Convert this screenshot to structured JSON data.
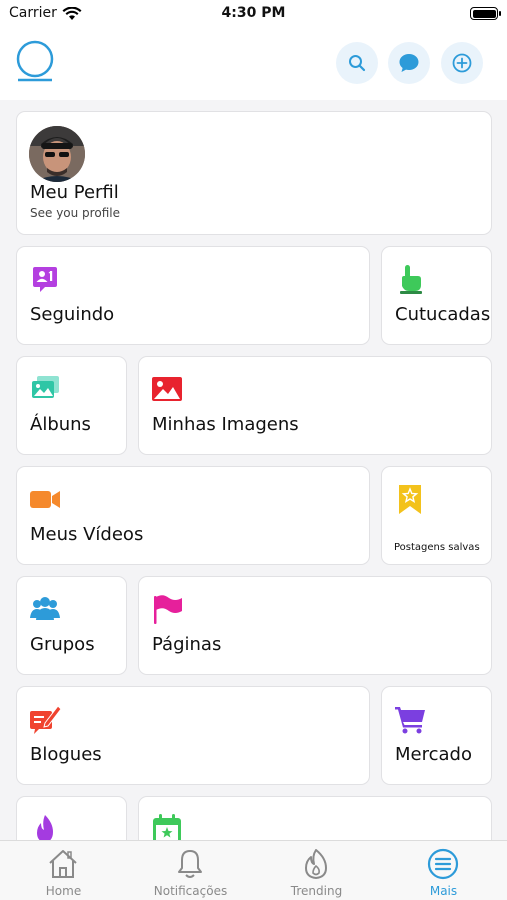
{
  "status_bar": {
    "carrier": "Carrier",
    "time": "4:30 PM"
  },
  "header": {
    "logo_icon": "ring-logo-icon",
    "search_icon": "search-icon",
    "chat_icon": "chat-bubble-icon",
    "add_icon": "plus-circle-icon",
    "accent": "#2d9bd9"
  },
  "profile": {
    "name": "Meu Perfil",
    "subtitle": "See you profile"
  },
  "menu": [
    {
      "key": "seguindo",
      "label": "Seguindo",
      "icon": "following-icon",
      "color": "#b43fe0"
    },
    {
      "key": "cutucadas",
      "label": "Cutucadas",
      "icon": "poke-hand-icon",
      "color": "#3ec95a"
    },
    {
      "key": "albuns",
      "label": "Álbuns",
      "icon": "photo-album-icon",
      "color": "#2fc6a6"
    },
    {
      "key": "minhas_imagens",
      "label": "Minhas Imagens",
      "icon": "image-icon",
      "color": "#e8232e"
    },
    {
      "key": "meus_videos",
      "label": "Meus Vídeos",
      "icon": "video-camera-icon",
      "color": "#f5892c"
    },
    {
      "key": "postagens_salvas",
      "label": "Postagens salvas",
      "icon": "bookmark-star-icon",
      "color": "#f3c21c"
    },
    {
      "key": "grupos",
      "label": "Grupos",
      "icon": "group-icon",
      "color": "#2d9bd9"
    },
    {
      "key": "paginas",
      "label": "Páginas",
      "icon": "flag-icon",
      "color": "#e6209b"
    },
    {
      "key": "blogues",
      "label": "Blogues",
      "icon": "blog-pencil-icon",
      "color": "#f0432f"
    },
    {
      "key": "mercado",
      "label": "Mercado",
      "icon": "shopping-cart-icon",
      "color": "#7b3fe0"
    },
    {
      "key": "fire",
      "label": "",
      "icon": "fire-icon",
      "color": "#a43be0"
    },
    {
      "key": "events",
      "label": "",
      "icon": "calendar-icon",
      "color": "#3ec95a"
    }
  ],
  "tabs": [
    {
      "label": "Home",
      "icon": "home-icon",
      "active": false
    },
    {
      "label": "Notificações",
      "icon": "bell-icon",
      "active": false
    },
    {
      "label": "Trending",
      "icon": "fire-icon",
      "active": false
    },
    {
      "label": "Mais",
      "icon": "menu-lines-icon",
      "active": true
    }
  ],
  "tab_inactive_color": "#8a8a8a"
}
